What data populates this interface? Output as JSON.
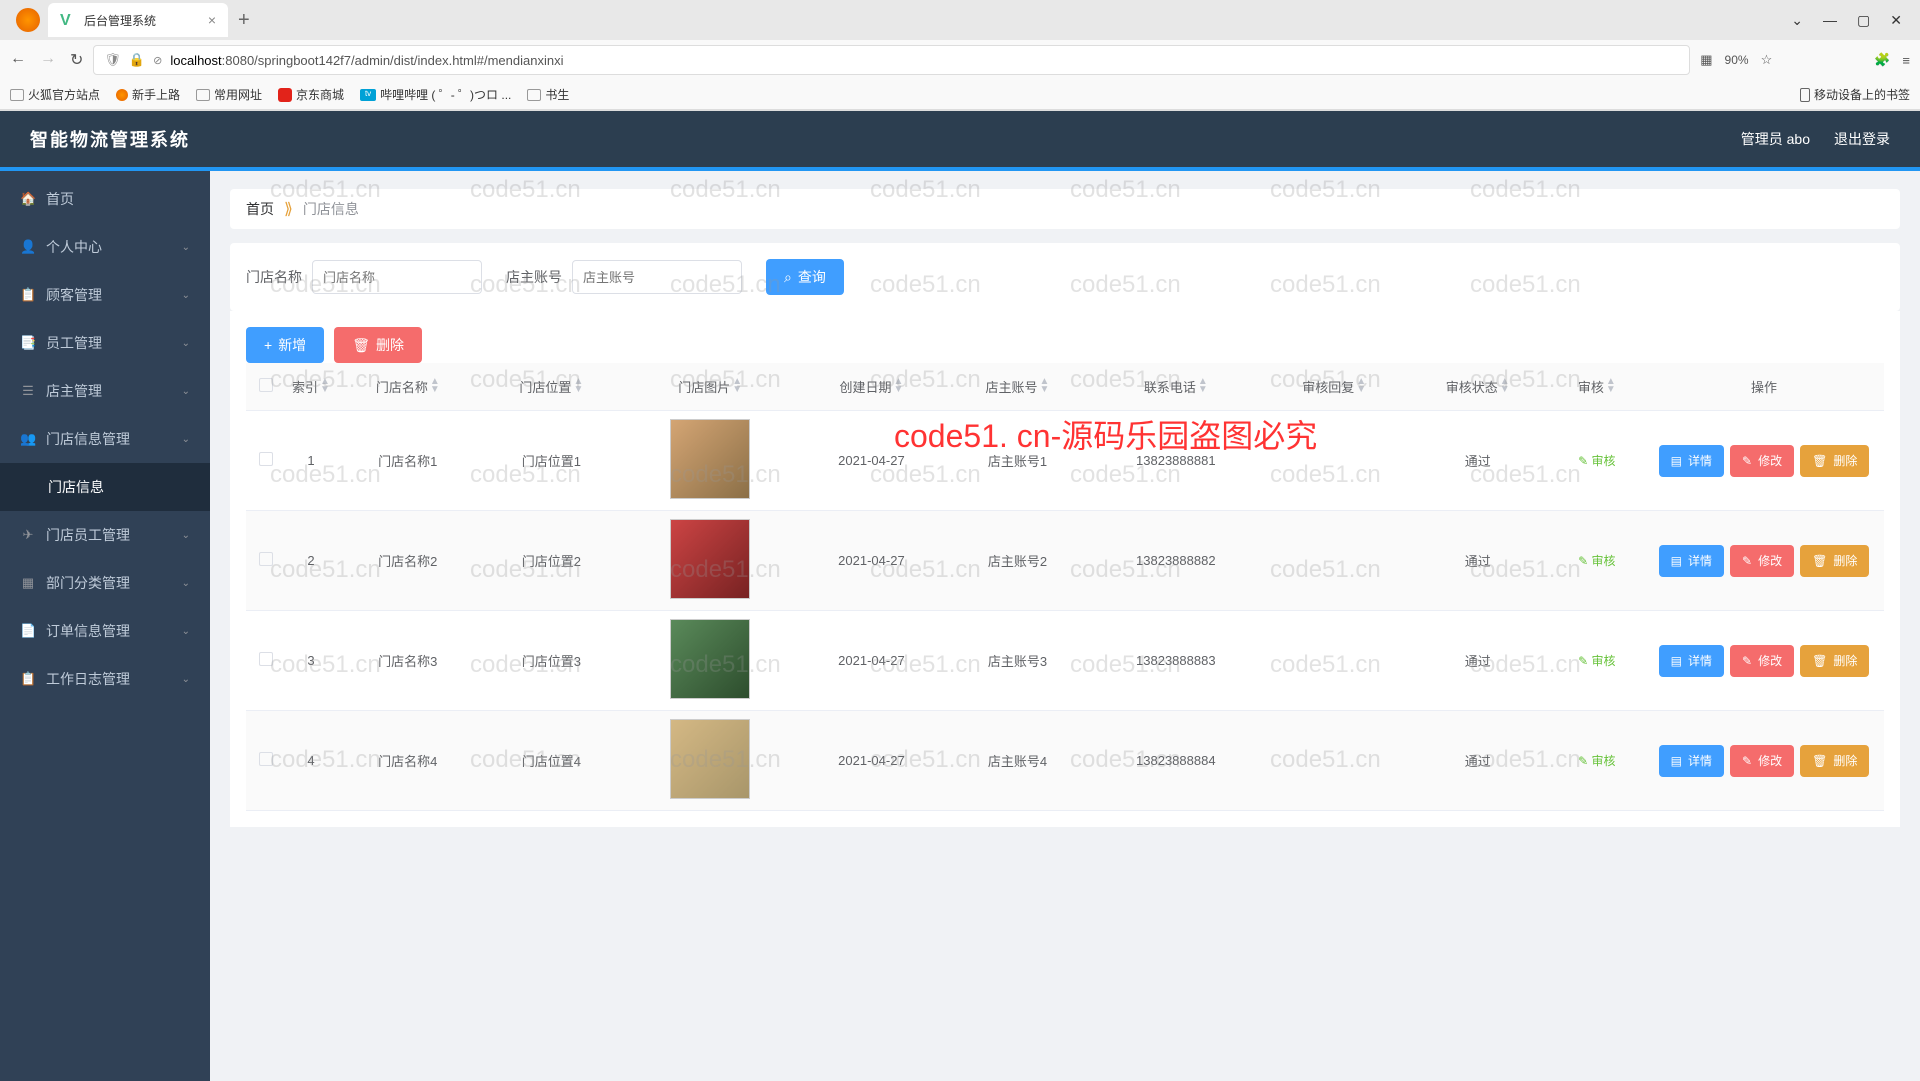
{
  "browser": {
    "tab_title": "后台管理系统",
    "url_host": "localhost",
    "url_path": ":8080/springboot142f7/admin/dist/index.html#/mendianxinxi",
    "zoom": "90%",
    "bookmarks": [
      "火狐官方站点",
      "新手上路",
      "常用网址",
      "京东商城",
      "哔哩哔哩 ( ゜- ゜)つロ ...",
      "书生"
    ],
    "mobile_bookmark": "移动设备上的书签"
  },
  "app": {
    "title": "智能物流管理系统",
    "user_label": "管理员 abo",
    "logout": "退出登录"
  },
  "sidebar": {
    "items": [
      {
        "label": "首页",
        "icon": "🏠",
        "expandable": false
      },
      {
        "label": "个人中心",
        "icon": "👤",
        "expandable": true
      },
      {
        "label": "顾客管理",
        "icon": "📋",
        "expandable": true
      },
      {
        "label": "员工管理",
        "icon": "📑",
        "expandable": true
      },
      {
        "label": "店主管理",
        "icon": "☰",
        "expandable": true
      },
      {
        "label": "门店信息管理",
        "icon": "👥",
        "expandable": true
      },
      {
        "label": "门店信息",
        "icon": "",
        "expandable": false,
        "sub": true,
        "active": true
      },
      {
        "label": "门店员工管理",
        "icon": "✈",
        "expandable": true
      },
      {
        "label": "部门分类管理",
        "icon": "▦",
        "expandable": true
      },
      {
        "label": "订单信息管理",
        "icon": "📄",
        "expandable": true
      },
      {
        "label": "工作日志管理",
        "icon": "📋",
        "expandable": true
      }
    ]
  },
  "breadcrumb": {
    "home": "首页",
    "current": "门店信息"
  },
  "search": {
    "name_label": "门店名称",
    "name_placeholder": "门店名称",
    "account_label": "店主账号",
    "account_placeholder": "店主账号",
    "query_btn": "查询"
  },
  "actions": {
    "add": "新增",
    "delete": "删除"
  },
  "table": {
    "headers": [
      "",
      "索引",
      "门店名称",
      "门店位置",
      "门店图片",
      "创建日期",
      "店主账号",
      "联系电话",
      "审核回复",
      "审核状态",
      "审核",
      "操作"
    ],
    "rows": [
      {
        "idx": "1",
        "name": "门店名称1",
        "loc": "门店位置1",
        "date": "2021-04-27",
        "acct": "店主账号1",
        "phone": "13823888881",
        "reply": "",
        "status": "通过"
      },
      {
        "idx": "2",
        "name": "门店名称2",
        "loc": "门店位置2",
        "date": "2021-04-27",
        "acct": "店主账号2",
        "phone": "13823888882",
        "reply": "",
        "status": "通过"
      },
      {
        "idx": "3",
        "name": "门店名称3",
        "loc": "门店位置3",
        "date": "2021-04-27",
        "acct": "店主账号3",
        "phone": "13823888883",
        "reply": "",
        "status": "通过"
      },
      {
        "idx": "4",
        "name": "门店名称4",
        "loc": "门店位置4",
        "date": "2021-04-27",
        "acct": "店主账号4",
        "phone": "13823888884",
        "reply": "",
        "status": "通过"
      }
    ],
    "audit_btn": "审核",
    "detail_btn": "详情",
    "edit_btn": "修改",
    "del_btn": "删除"
  },
  "watermark": {
    "grey": "code51.cn",
    "red": "code51. cn-源码乐园盗图必究"
  }
}
